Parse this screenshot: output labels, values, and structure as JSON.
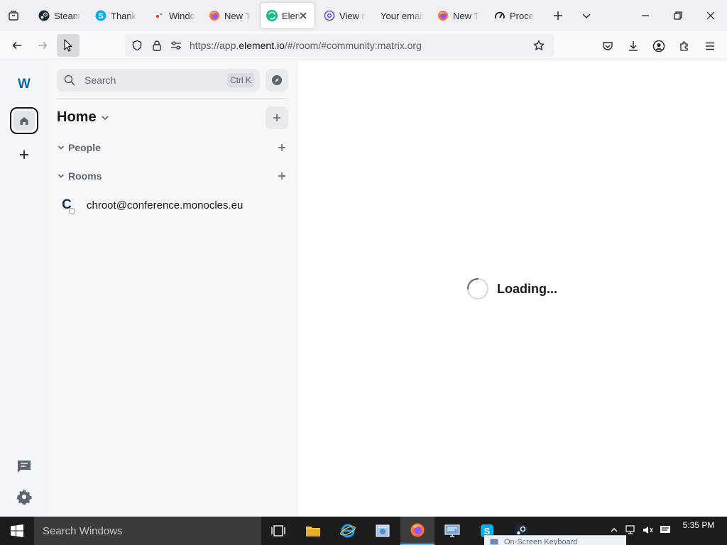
{
  "browser": {
    "tabs": [
      {
        "title": "Steam",
        "icon": "steam-icon",
        "active": false
      },
      {
        "title": "Thank",
        "icon": "skype-icon",
        "active": false
      },
      {
        "title": "Windo",
        "icon": "windows-tab-icon",
        "active": false
      },
      {
        "title": "New T",
        "icon": "firefox-icon",
        "active": false
      },
      {
        "title": "Elem",
        "icon": "element-icon",
        "active": true
      },
      {
        "title": "View r",
        "icon": "at-sign-icon",
        "active": false
      },
      {
        "title": "Your email",
        "icon": "",
        "active": false
      },
      {
        "title": "New T",
        "icon": "firefox-icon",
        "active": false
      },
      {
        "title": "Proce",
        "icon": "gauge-icon",
        "active": false
      }
    ],
    "url": {
      "prefix": "https://app.",
      "host": "element.io",
      "path": "/#/room/#community:matrix.org"
    }
  },
  "app": {
    "space_avatar": "W",
    "search": {
      "label": "Search",
      "shortcut": "Ctrl K"
    },
    "home_title": "Home",
    "sections": {
      "people": "People",
      "rooms": "Rooms"
    },
    "rooms": [
      {
        "avatar_letter": "C",
        "name": "chroot@conference.monocles.eu"
      }
    ],
    "loading_text": "Loading..."
  },
  "taskbar": {
    "search_placeholder": "Search Windows",
    "osk_label": "On-Screen Keyboard",
    "clock": "5:35 PM"
  },
  "colors": {
    "accent": "#0dbd8b",
    "firefox_orange": "#ff7139",
    "taskbar_bg": "#1c1c1c"
  }
}
